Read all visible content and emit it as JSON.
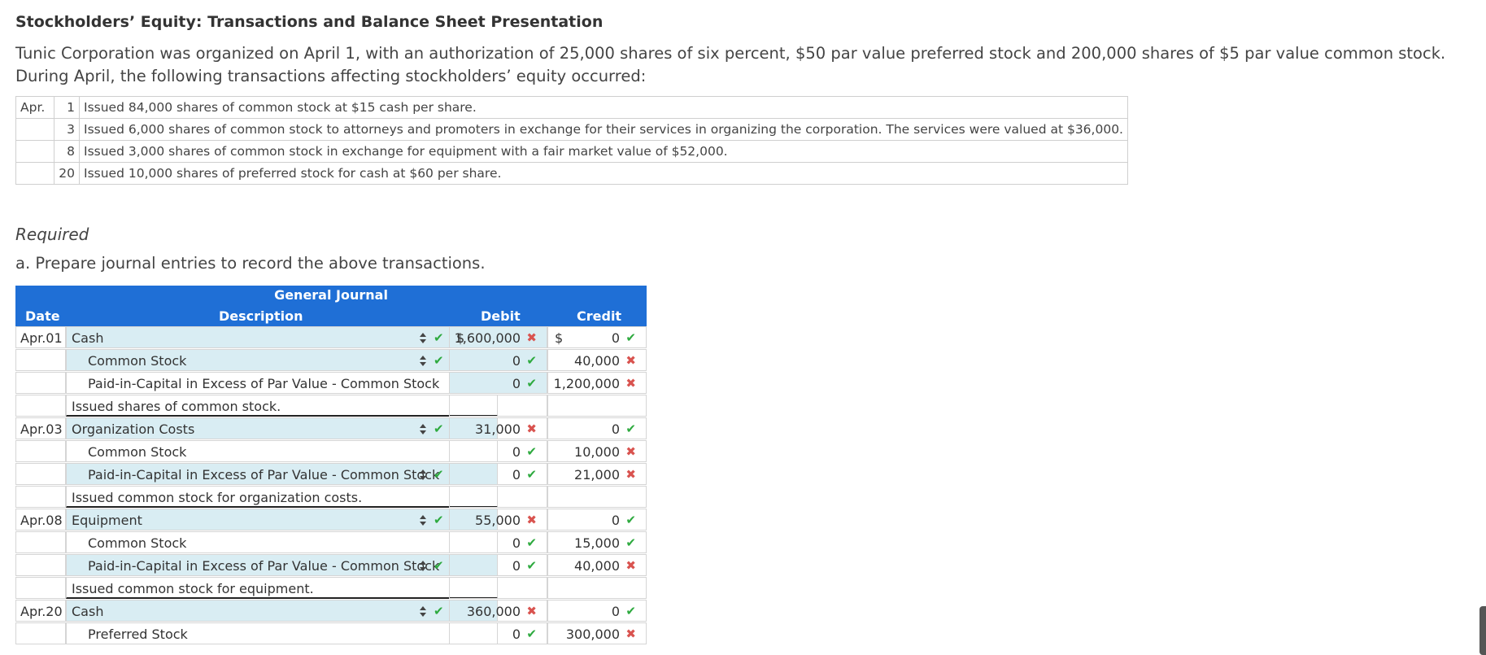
{
  "title": "Stockholders’ Equity: Transactions and Balance Sheet Presentation",
  "intro": "Tunic Corporation was organized on April 1, with an authorization of 25,000 shares of six percent, $50 par value preferred stock and 200,000 shares of $5 par value common stock. During April, the following transactions affecting stockholders’ equity occurred:",
  "transactions": [
    {
      "month": "Apr.",
      "day": "1",
      "text": "Issued 84,000 shares of common stock at $15 cash per share."
    },
    {
      "month": "",
      "day": "3",
      "text": "Issued 6,000 shares of common stock to attorneys and promoters in exchange for their services in organizing the corporation. The services were valued at $36,000."
    },
    {
      "month": "",
      "day": "8",
      "text": "Issued 3,000 shares of common stock in exchange for equipment with a fair market value of $52,000."
    },
    {
      "month": "",
      "day": "20",
      "text": "Issued 10,000 shares of preferred stock for cash at $60 per share."
    }
  ],
  "required": "Required",
  "instruction": "a. Prepare journal entries to record the above transactions.",
  "journal": {
    "title": "General Journal",
    "col_date": "Date",
    "col_desc": "Description",
    "col_debit": "Debit",
    "col_credit": "Credit",
    "rows": [
      {
        "date": "Apr.01",
        "desc": "Cash",
        "debit": "1,600,000",
        "credit": "0"
      },
      {
        "date": "",
        "desc": "Common Stock",
        "debit": "0",
        "credit": "40,000"
      },
      {
        "date": "",
        "desc": "Paid-in-Capital in Excess of Par Value - Common Stock",
        "debit": "0",
        "credit": "1,200,000"
      },
      {
        "date": "",
        "desc": "Issued shares of common stock.",
        "debit": "",
        "credit": ""
      },
      {
        "date": "Apr.03",
        "desc": "Organization Costs",
        "debit": "31,000",
        "credit": "0"
      },
      {
        "date": "",
        "desc": "Common Stock",
        "debit": "0",
        "credit": "10,000"
      },
      {
        "date": "",
        "desc": "Paid-in-Capital in Excess of Par Value - Common Stock",
        "debit": "0",
        "credit": "21,000"
      },
      {
        "date": "",
        "desc": "Issued common stock for organization costs.",
        "debit": "",
        "credit": ""
      },
      {
        "date": "Apr.08",
        "desc": "Equipment",
        "debit": "55,000",
        "credit": "0"
      },
      {
        "date": "",
        "desc": "Common Stock",
        "debit": "0",
        "credit": "15,000"
      },
      {
        "date": "",
        "desc": "Paid-in-Capital in Excess of Par Value - Common Stock",
        "debit": "0",
        "credit": "40,000"
      },
      {
        "date": "",
        "desc": "Issued common stock for equipment.",
        "debit": "",
        "credit": ""
      },
      {
        "date": "Apr.20",
        "desc": "Cash",
        "debit": "360,000",
        "credit": "0"
      },
      {
        "date": "",
        "desc": "Preferred Stock",
        "debit": "0",
        "credit": "300,000"
      }
    ]
  },
  "colors": {
    "header_blue": "#1f6fd6",
    "input_fill": "#d9edf3",
    "check_green": "#2eaa3f",
    "cross_red": "#d9534f"
  }
}
